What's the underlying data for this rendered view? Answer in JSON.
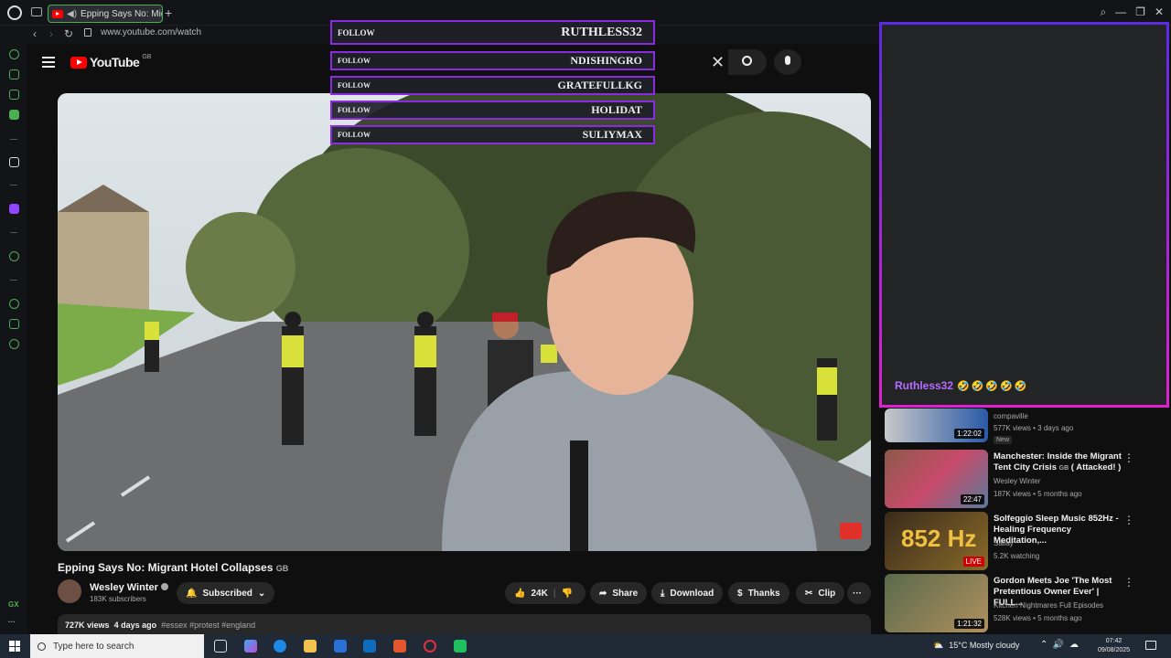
{
  "browser": {
    "tab_title": "Epping Says No: Migr",
    "new_tab": "+",
    "url": "www.youtube.com/watch",
    "back": "‹",
    "forward": "›",
    "reload": "↻",
    "window_controls": [
      "⌕",
      "—",
      "❐",
      "✕"
    ]
  },
  "sidebar": {
    "bottom_label": "GX",
    "more": "···"
  },
  "youtube": {
    "logo_text": "YouTube",
    "region": "GB",
    "search_clear": "✕"
  },
  "follow_overlay": [
    {
      "label": "FOLLOW",
      "name": "RUTHLESS32"
    },
    {
      "label": "FOLLOW",
      "name": "NDISHINGRO"
    },
    {
      "label": "FOLLOW",
      "name": "GRATEFULLKG"
    },
    {
      "label": "FOLLOW",
      "name": "HOLIDAT"
    },
    {
      "label": "FOLLOW",
      "name": "SULIYMAX"
    }
  ],
  "chat": {
    "username": "Ruthless32",
    "emotes": "🤣🤣🤣🤣🤣"
  },
  "video": {
    "title": "Epping Says No: Migrant Hotel Collapses",
    "title_region": "GB",
    "channel": "Wesley Winter",
    "subscribers": "183K subscribers",
    "subscribed_label": "Subscribed",
    "likes": "24K",
    "share": "Share",
    "download": "Download",
    "thanks": "Thanks",
    "clip": "Clip",
    "more": "···",
    "views": "727K views",
    "age": "4 days ago",
    "tags": "#essex #protest #england"
  },
  "recommendations": [
    {
      "title": "",
      "channel": "compaville",
      "meta": "577K views • 3 days ago",
      "duration": "1:22:02",
      "badge": "New",
      "live": false
    },
    {
      "title": "Manchester: Inside the Migrant Tent City Crisis",
      "region": "GB",
      "title_suffix": "( Attacked! )",
      "channel": "Wesley Winter",
      "meta": "187K views • 5 months ago",
      "duration": "22:47",
      "live": false
    },
    {
      "title": "Solfeggio Sleep Music 852Hz - Healing Frequency Meditation,...",
      "channel": "Sallay",
      "meta": "5.2K watching",
      "duration": "LIVE",
      "thumb_text": "852 Hz",
      "live": true
    },
    {
      "title": "Gordon Meets Joe 'The Most Pretentious Owner Ever' | FULL...",
      "channel": "Kitchen Nightmares Full Episodes",
      "meta": "528K views • 5 months ago",
      "duration": "1:21:32",
      "live": false
    }
  ],
  "taskbar": {
    "search_placeholder": "Type here to search",
    "weather": "15°C  Mostly cloudy",
    "time": "07:42",
    "date": "09/08/2025"
  },
  "colors": {
    "overlay_border": "#8a2be2",
    "chat_name": "#b46eff",
    "accent_green": "#4caf50",
    "youtube_red": "#ff0000"
  }
}
